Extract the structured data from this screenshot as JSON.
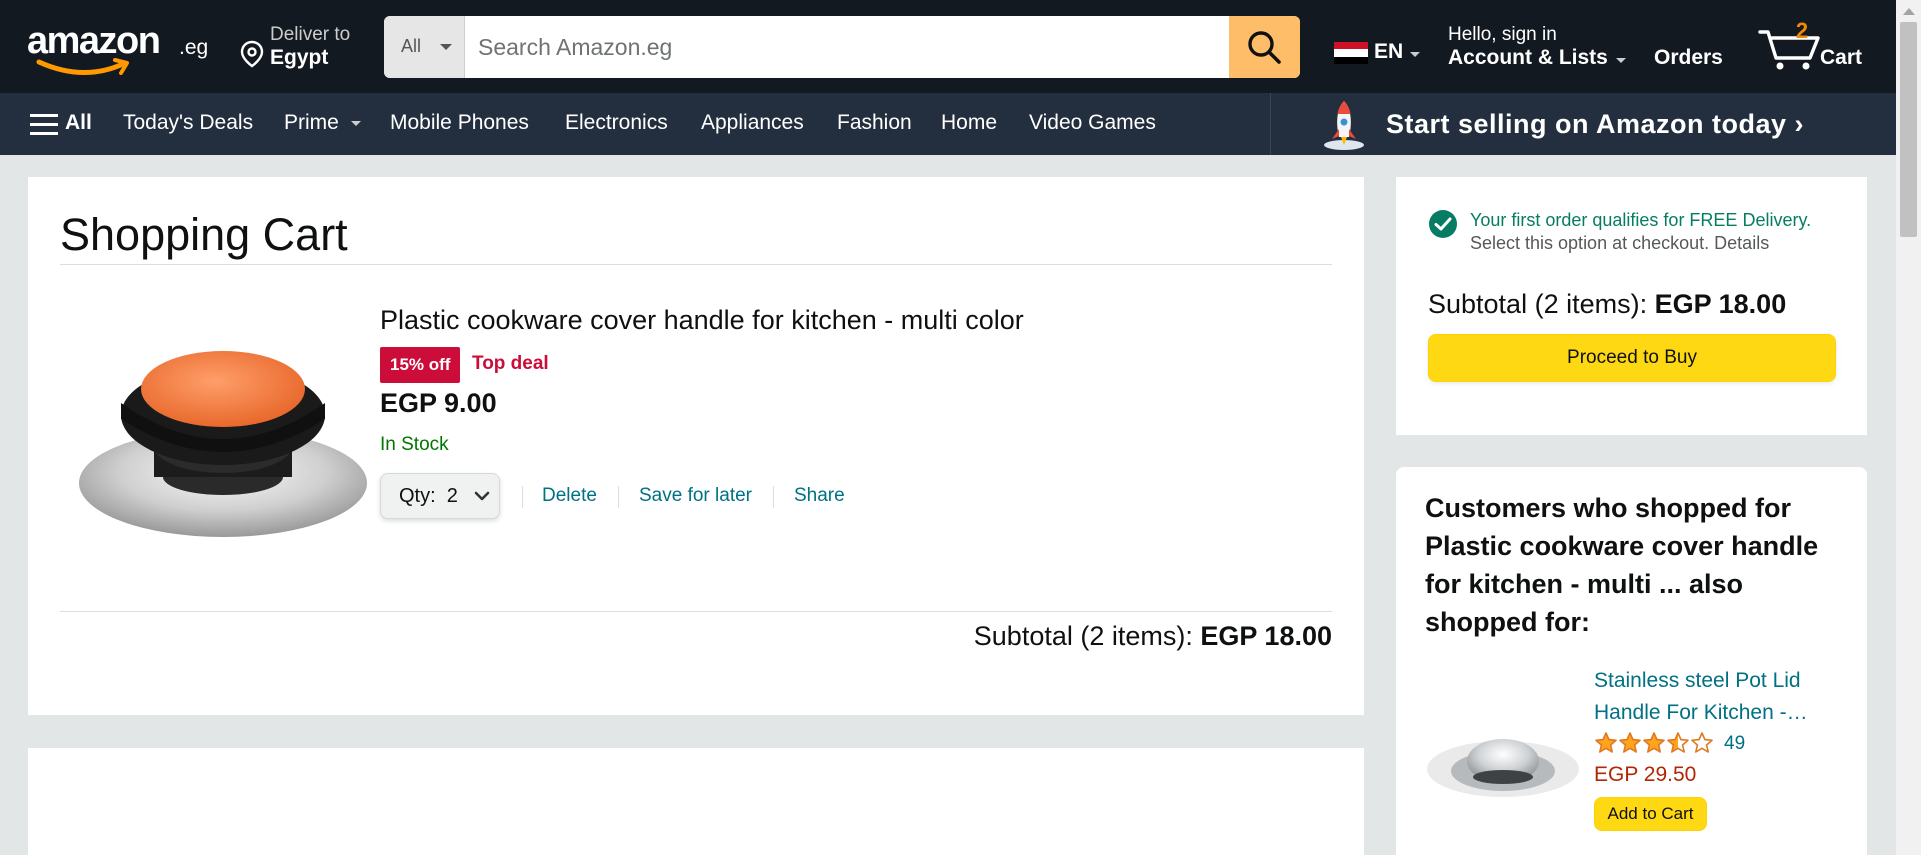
{
  "header": {
    "logo_text": "amazon",
    "logo_tld": ".eg",
    "deliver_to_label": "Deliver to",
    "deliver_to_location": "Egypt",
    "search_category": "All",
    "search_placeholder": "Search Amazon.eg",
    "language": "EN",
    "account_greeting": "Hello, sign in",
    "account_label": "Account & Lists",
    "orders_label": "Orders",
    "cart_count": "2",
    "cart_label": "Cart"
  },
  "nav": {
    "all_label": "All",
    "items": [
      "Today's Deals",
      "Prime",
      "Mobile Phones",
      "Electronics",
      "Appliances",
      "Fashion",
      "Home",
      "Video Games"
    ],
    "promo": "Start selling on Amazon today ›"
  },
  "cart": {
    "title": "Shopping Cart",
    "item": {
      "title": "Plastic cookware cover handle for kitchen - multi color",
      "discount_badge": "15% off",
      "deal_label": "Top deal",
      "price": "EGP 9.00",
      "stock": "In Stock",
      "qty_label": "Qty:",
      "qty_value": "2",
      "delete_label": "Delete",
      "save_label": "Save for later",
      "share_label": "Share"
    },
    "subtotal_label": "Subtotal (2 items):",
    "subtotal_value": "EGP 18.00"
  },
  "summary": {
    "free_delivery": "Your first order qualifies for FREE Delivery.",
    "select_option": "Select this option at checkout.",
    "details_link": "Details",
    "subtotal_label": "Subtotal (2 items):",
    "subtotal_value": "EGP 18.00",
    "proceed_label": "Proceed to Buy"
  },
  "recommendations": {
    "heading": "Customers who shopped for Plastic cookware cover handle for kitchen - multi ... also shopped for:",
    "item": {
      "title": "Stainless steel Pot Lid Handle For Kitchen -…",
      "rating": 3.5,
      "review_count": "49",
      "price": "EGP 29.50",
      "add_label": "Add to Cart"
    }
  },
  "colors": {
    "header_bg": "#131921",
    "nav_bg": "#232f3e",
    "search_button": "#febd69",
    "accent_yellow": "#ffd814",
    "deal_red": "#cc0c39",
    "link_teal": "#007185",
    "stock_green": "#007600",
    "price_red": "#b12704",
    "cart_count_orange": "#f08804"
  },
  "icons": [
    "location-pin-icon",
    "search-icon",
    "egypt-flag-icon",
    "cart-icon",
    "hamburger-menu-icon",
    "rocket-icon",
    "check-circle-icon",
    "chevron-down-icon",
    "star-icon"
  ]
}
